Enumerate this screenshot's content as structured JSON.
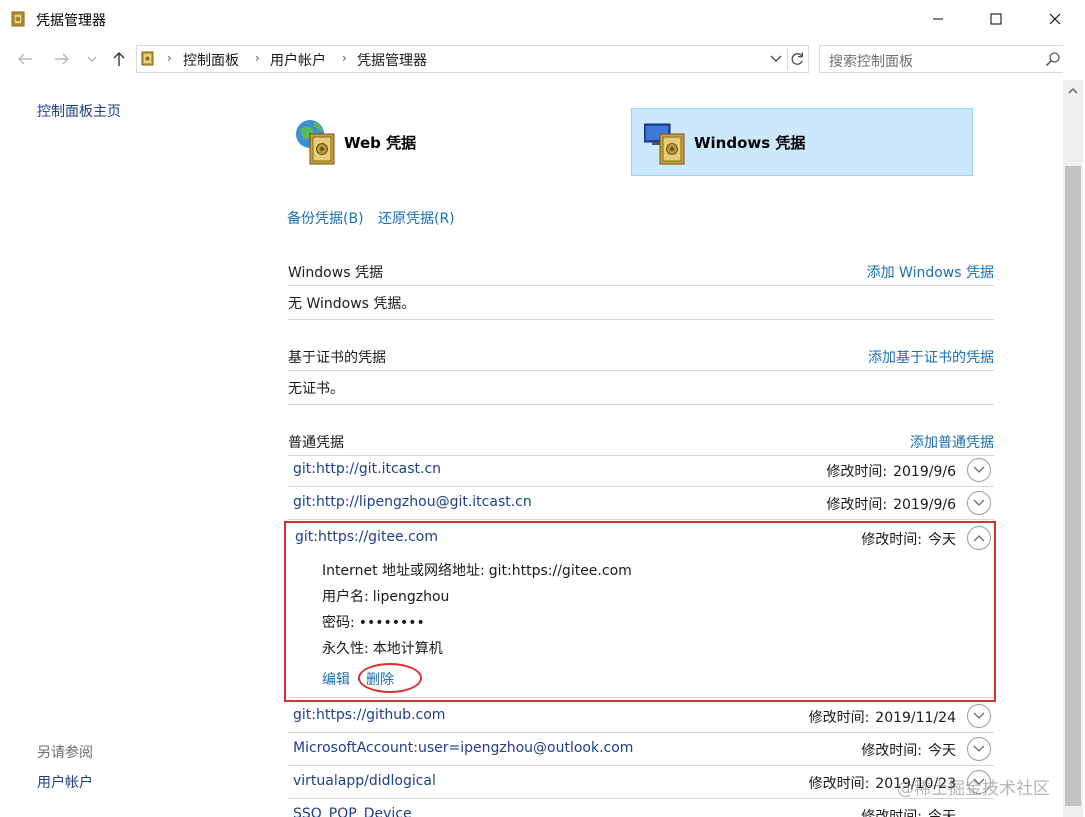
{
  "window": {
    "title": "凭据管理器"
  },
  "breadcrumb": [
    "控制面板",
    "用户帐户",
    "凭据管理器"
  ],
  "search": {
    "placeholder": "搜索控制面板"
  },
  "left_pane": {
    "home": "控制面板主页",
    "see_also": "另请参阅",
    "user_accounts": "用户帐户"
  },
  "cards": {
    "web": "Web 凭据",
    "windows": "Windows 凭据"
  },
  "links": {
    "backup": "备份凭据(B)",
    "restore": "还原凭据(R)"
  },
  "sections": {
    "windows": {
      "title": "Windows 凭据",
      "add": "添加 Windows 凭据",
      "empty": "无 Windows 凭据。"
    },
    "cert": {
      "title": "基于证书的凭据",
      "add": "添加基于证书的凭据",
      "empty": "无证书。"
    },
    "generic": {
      "title": "普通凭据",
      "add": "添加普通凭据"
    }
  },
  "modified_label": "修改时间:",
  "credentials": [
    {
      "name": "git:http://git.itcast.cn",
      "date": "2019/9/6"
    },
    {
      "name": "git:http://lipengzhou@git.itcast.cn",
      "date": "2019/9/6"
    },
    {
      "name": "git:https://gitee.com",
      "date": "今天"
    },
    {
      "name": "git:https://github.com",
      "date": "2019/11/24"
    },
    {
      "name": "MicrosoftAccount:user=ipengzhou@outlook.com",
      "date": "今天"
    },
    {
      "name": "virtualapp/didlogical",
      "date": "2019/10/23"
    },
    {
      "name": "SSO_POP_Device",
      "date": "今天"
    }
  ],
  "expanded_detail": {
    "address_label": "Internet 地址或网络地址:",
    "address": "git:https://gitee.com",
    "user_label": "用户名:",
    "user": "lipengzhou",
    "password_label": "密码:",
    "password": "••••••••",
    "persistence_label": "永久性:",
    "persistence": "本地计算机",
    "edit": "编辑",
    "delete": "删除"
  },
  "watermark": "@稀土掘金技术社区",
  "colors": {
    "link": "#1a6fb5",
    "selected_card": "#cce8ff",
    "highlight": "#d93030"
  }
}
